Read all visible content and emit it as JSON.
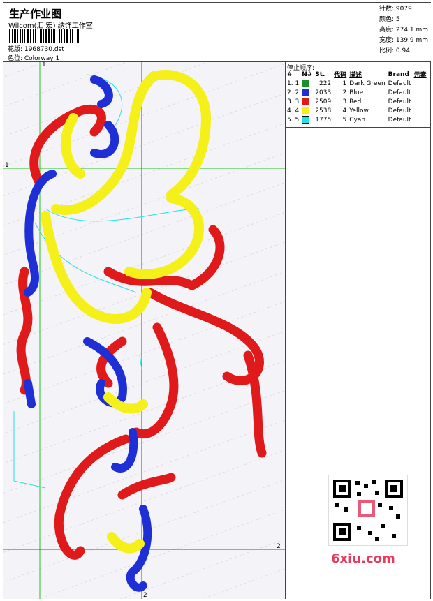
{
  "header": {
    "title": "生产作业图",
    "studio": "Wilcom(汇 宏) 绣饰工作室",
    "design_label": "花版: 1968730.dst",
    "colorway_label": "色位: Colorway 1"
  },
  "stats": {
    "stitches": "针数: 9079",
    "colors": "颜色: 5",
    "height": "高度: 274.1 mm",
    "width": "宽度: 139.9 mm",
    "scale": "比例: 0.94"
  },
  "sequence": {
    "title": "停止顺序:",
    "headers": [
      "#",
      "N#",
      "St.",
      "代码",
      "描述",
      "Brand",
      "元素"
    ],
    "rows": [
      {
        "n": "1. 1",
        "color": "#1a8f2a",
        "st": "222",
        "code": "1",
        "desc": "Dark Green",
        "brand": "Default"
      },
      {
        "n": "2. 2",
        "color": "#1f2fd6",
        "st": "2033",
        "code": "2",
        "desc": "Blue",
        "brand": "Default"
      },
      {
        "n": "3. 3",
        "color": "#e01a1a",
        "st": "2509",
        "code": "3",
        "desc": "Red",
        "brand": "Default"
      },
      {
        "n": "4. 4",
        "color": "#f5f01a",
        "st": "2538",
        "code": "4",
        "desc": "Yellow",
        "brand": "Default"
      },
      {
        "n": "5. 5",
        "color": "#1fe3e3",
        "st": "1775",
        "code": "5",
        "desc": "Cyan",
        "brand": "Default"
      }
    ]
  },
  "markers": {
    "one": "1",
    "two": "2"
  },
  "watermark": "6xiu.com",
  "colors": {
    "red": "#e01a1a",
    "blue": "#1f2fd6",
    "yellow": "#f5f01a",
    "cyan": "#1fe3e3",
    "green_guide": "#22c322",
    "red_guide": "#e01a1a"
  }
}
